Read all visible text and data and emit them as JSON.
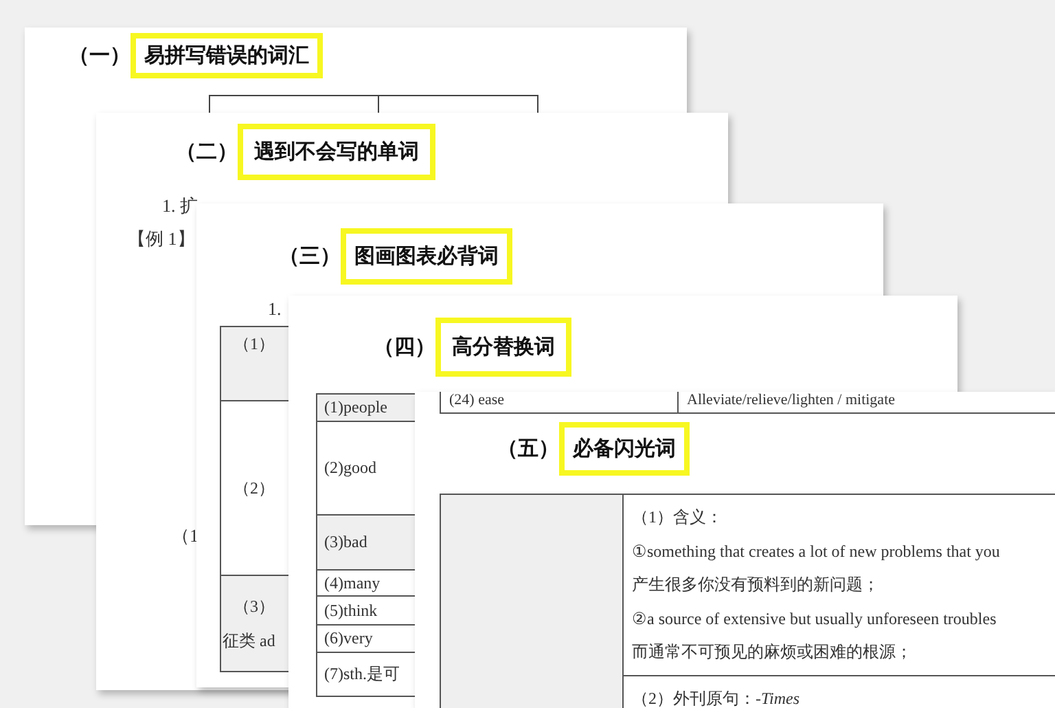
{
  "pages": [
    {
      "number": "（一）",
      "title": "易拼写错误的词汇",
      "highlighted": true
    },
    {
      "number": "（二）",
      "title": "遇到不会写的单词",
      "highlighted": true,
      "lines": [
        "1. 扩",
        "【例 1】",
        "（1"
      ]
    },
    {
      "number": "（三）",
      "title": "图画图表必背词",
      "highlighted": true,
      "lines": [
        "1."
      ],
      "table_rows": [
        {
          "cells": [
            "（1）"
          ],
          "shaded": true
        },
        {
          "cells": [
            "（2）"
          ],
          "shaded": false
        },
        {
          "cells": [
            "（3）",
            "征类 ad"
          ],
          "shaded": true
        }
      ]
    },
    {
      "number": "（四）",
      "title": "高分替换词",
      "highlighted": true,
      "table_rows": [
        {
          "cells": [
            "(1)people"
          ],
          "shaded": true
        },
        {
          "cells": [
            "(2)good"
          ],
          "shaded": false
        },
        {
          "cells": [
            "(3)bad"
          ],
          "shaded": true
        },
        {
          "cells": [
            "(4)many"
          ],
          "shaded": false
        },
        {
          "cells": [
            "(5)think"
          ],
          "shaded": false
        },
        {
          "cells": [
            "(6)very"
          ],
          "shaded": false
        },
        {
          "cells": [
            "(7)sth.是可"
          ],
          "shaded": false
        }
      ]
    },
    {
      "number": "（五）",
      "title": "必备闪光词",
      "highlighted": true,
      "top_row": [
        "(24) ease",
        "Alleviate/relieve/lighten / mitigate"
      ],
      "definition_blocks": [
        [
          "（1）含义：",
          "①something that creates a lot of new problems that you",
          "产生很多你没有预料到的新问题；",
          "②a source of extensive but usually unforeseen troubles",
          "而通常不可预见的麻烦或困难的根源；"
        ],
        [
          "（2）外刊原句：-*Times*"
        ]
      ]
    }
  ]
}
